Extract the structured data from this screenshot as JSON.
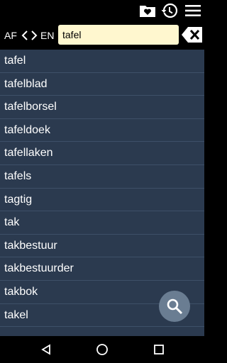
{
  "toolbar": {
    "icons": [
      "favorites-heart-icon",
      "history-icon",
      "menu-icon"
    ]
  },
  "search": {
    "source_lang": "AF",
    "target_lang": "EN",
    "query": "tafel"
  },
  "results": [
    "tafel",
    "tafelblad",
    "tafelborsel",
    "tafeldoek",
    "tafellaken",
    "tafels",
    "tagtig",
    "tak",
    "takbestuur",
    "takbestuurder",
    "takbok",
    "takel"
  ],
  "colors": {
    "background": "#2b3a4f",
    "input": "#fff7cf",
    "divider": "#3e5068",
    "fab": "#6a7d92"
  }
}
